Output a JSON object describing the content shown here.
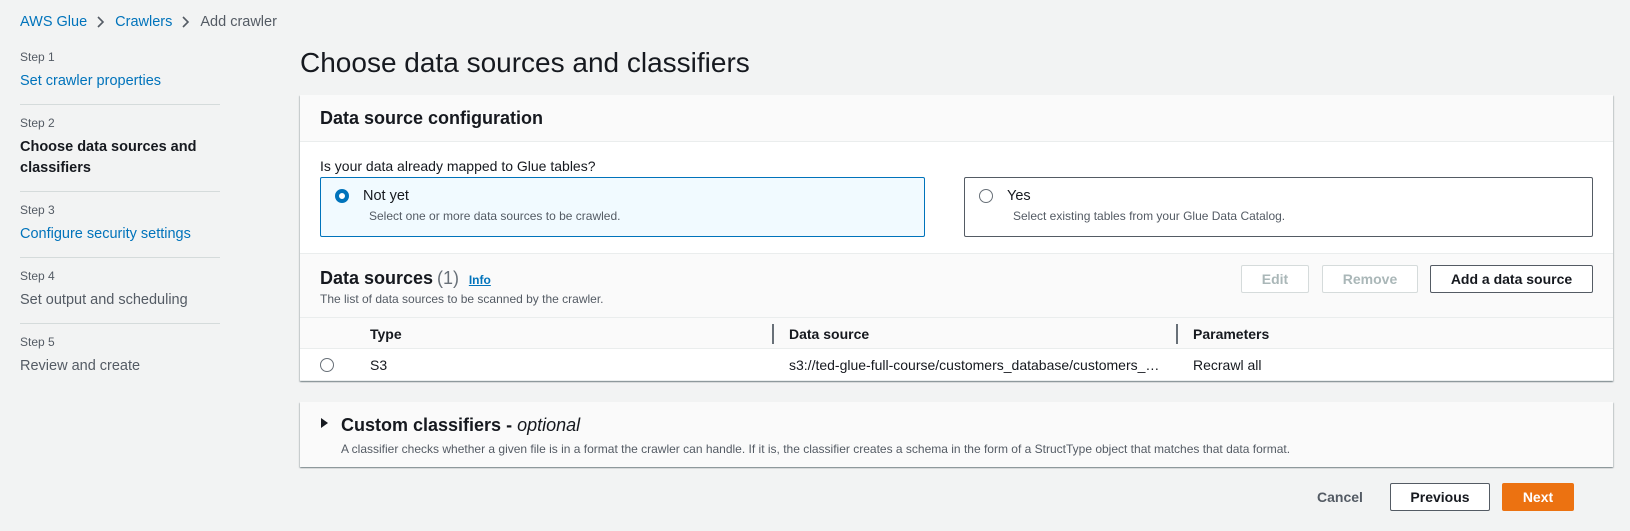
{
  "breadcrumb": {
    "items": [
      "AWS Glue",
      "Crawlers"
    ],
    "current": "Add crawler"
  },
  "steps": [
    {
      "num": "Step 1",
      "label": "Set crawler properties",
      "state": "link"
    },
    {
      "num": "Step 2",
      "label": "Choose data sources and classifiers",
      "state": "active"
    },
    {
      "num": "Step 3",
      "label": "Configure security settings",
      "state": "link"
    },
    {
      "num": "Step 4",
      "label": "Set output and scheduling",
      "state": "disabled"
    },
    {
      "num": "Step 5",
      "label": "Review and create",
      "state": "disabled"
    }
  ],
  "page_title": "Choose data sources and classifiers",
  "config": {
    "title": "Data source configuration",
    "question": "Is your data already mapped to Glue tables?",
    "options": [
      {
        "title": "Not yet",
        "desc": "Select one or more data sources to be crawled.",
        "selected": true
      },
      {
        "title": "Yes",
        "desc": "Select existing tables from your Glue Data Catalog.",
        "selected": false
      }
    ]
  },
  "data_sources": {
    "title": "Data sources",
    "count": "(1)",
    "info": "Info",
    "desc": "The list of data sources to be scanned by the crawler.",
    "buttons": {
      "edit": "Edit",
      "remove": "Remove",
      "add": "Add a data source"
    },
    "columns": [
      "Type",
      "Data source",
      "Parameters"
    ],
    "rows": [
      {
        "type": "S3",
        "source": "s3://ted-glue-full-course/customers_database/customers_…",
        "params": "Recrawl all"
      }
    ]
  },
  "classifiers": {
    "title": "Custom classifiers - ",
    "optional": "optional",
    "desc": "A classifier checks whether a given file is in a format the crawler can handle. If it is, the classifier creates a schema in the form of a StructType object that matches that data format."
  },
  "footer": {
    "cancel": "Cancel",
    "previous": "Previous",
    "next": "Next"
  },
  "colors": {
    "link": "#0073bb",
    "primary": "#ec7211"
  }
}
